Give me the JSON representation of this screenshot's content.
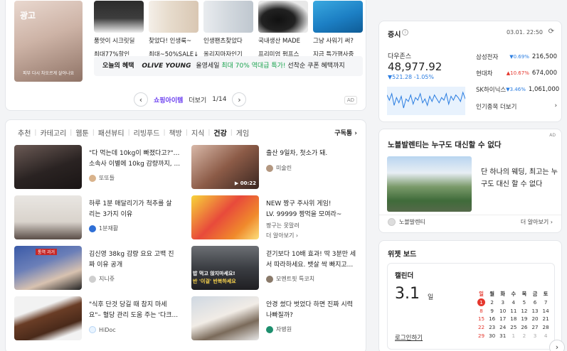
{
  "shopping": {
    "main_image_ad": "광고",
    "main_caption": "피부 다시 차오르게 살아나요",
    "products": [
      {
        "title": "품앗이 시크릿딜",
        "sub": "최대77%할인"
      },
      {
        "title": "찾았다! 인생룩~",
        "sub": "최대~50%SALE↓"
      },
      {
        "title": "인생팬츠찾았다",
        "sub": "올리지마자인기"
      },
      {
        "title": "국내생산 MADE",
        "sub": "프리미엄 펌프스"
      },
      {
        "title": "그냥 사워기 써?",
        "sub": "지금 특가행사중"
      }
    ],
    "highlight": {
      "tag": "오늘의 혜택",
      "brand": "OLIVE YOUNG",
      "text1": "올영세일",
      "accent": "최대 70% 역대급 특가!",
      "text2": "선착순 쿠폰 혜택까지"
    },
    "pager": {
      "title": "쇼핑아이템",
      "more": "더보기",
      "page": "1/14"
    },
    "ad": "AD"
  },
  "feed": {
    "tabs": [
      "추천",
      "카테고리",
      "웹툰",
      "패션뷰티",
      "리빙푸드",
      "책방",
      "지식",
      "건강",
      "게임"
    ],
    "active_tab": "건강",
    "subscribe": "구독통",
    "items": [
      {
        "l1": "\"다 먹는데 10kg이 빠졌다고?\"…",
        "l2": "소속사 이별에 10kg 감량까지, ...",
        "source": "또또들",
        "more": ""
      },
      {
        "l1": "출산 9일차, 첫소가 돼.",
        "l2": "",
        "source": "미술린",
        "more": "",
        "duration": "00:22"
      },
      {
        "l1": "하루 1분 매달리기가 척추를 살",
        "l2": "리는 3가지 이유",
        "source": "1분재활",
        "more": ""
      },
      {
        "l1": "NEW 짱구 주사위 게임!",
        "l2": "LV. 99999 짱먹을 모여라~",
        "source": "짱구는 못말려",
        "more": "더 알아보기"
      },
      {
        "l1": "김신영 38kg 감량 요요 고백 진",
        "l2": "짜 이유 공개",
        "source": "지니쥬",
        "more": ""
      },
      {
        "l1": "걷기보다 10배 효과! 딱 3분만 세",
        "l2": "서 따라하세요. 뱃살 싹 빠지고...",
        "source": "모멘트핏 특코치",
        "more": ""
      },
      {
        "l1": "\"식후 단것 당길 때 참지 마세",
        "l2": "요\"– 혈당 관리 도움 주는 '다크...",
        "source": "HiDoc",
        "more": ""
      },
      {
        "l1": "안경 썼다 벗었다 하면 진짜 시력",
        "l2": "나빠질까?",
        "source": "자병원",
        "more": ""
      }
    ],
    "thumb_texts": {
      "kim_badge": "통역 과거",
      "video_caption1": "밥 먹고 앉지마세요!",
      "video_caption2": "반 '이걸' 반복하세요"
    }
  },
  "stock": {
    "title": "증시",
    "time": "03.01. 22:50",
    "index_name": "다우존스",
    "index_value": "48,977.92",
    "index_change": "▼521.28 -1.05%",
    "rows": [
      {
        "name": "삼성전자",
        "pct": "▼0.69%",
        "price": "216,500",
        "dir": "down"
      },
      {
        "name": "현대차",
        "pct": "▲10.67%",
        "price": "674,000",
        "dir": "up"
      },
      {
        "name": "SK하이닉스",
        "pct": "▼3.46%",
        "price": "1,061,000",
        "dir": "down"
      }
    ],
    "popular": "인기종목 더보기",
    "chart_values": [
      30,
      26,
      31,
      22,
      28,
      24,
      29,
      20,
      27,
      25,
      30,
      23,
      28,
      26,
      31,
      24,
      27,
      22,
      29,
      25,
      30,
      27,
      24,
      28,
      26,
      31,
      23,
      29,
      26,
      30,
      28,
      25,
      32,
      27
    ]
  },
  "novel": {
    "title": "노블발렌티는 누구도 대신할 수 없다",
    "text": "단 하나의 웨딩, 최고는 누구도 대신 할 수 없다",
    "source": "노블발렌티",
    "more": "더 알아보기",
    "ad": "AD"
  },
  "widget": {
    "title": "위젯 보드",
    "calendar": {
      "title": "캘린더",
      "date": "3.1",
      "day": "일",
      "login": "로그인하기",
      "heads": [
        "일",
        "월",
        "화",
        "수",
        "목",
        "금",
        "토"
      ],
      "weeks": [
        [
          "1",
          "2",
          "3",
          "4",
          "5",
          "6",
          "7"
        ],
        [
          "8",
          "9",
          "10",
          "11",
          "12",
          "13",
          "14"
        ],
        [
          "15",
          "16",
          "17",
          "18",
          "19",
          "20",
          "21"
        ],
        [
          "22",
          "23",
          "24",
          "25",
          "26",
          "27",
          "28"
        ],
        [
          "29",
          "30",
          "31",
          "1",
          "2",
          "3",
          "4"
        ]
      ]
    }
  }
}
